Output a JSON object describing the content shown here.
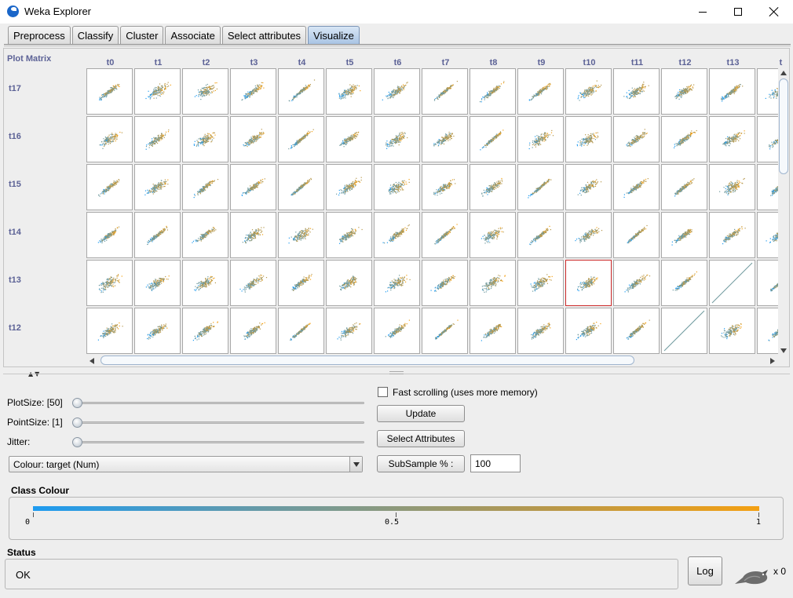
{
  "window": {
    "title": "Weka Explorer"
  },
  "tabs": [
    {
      "label": "Preprocess",
      "active": false
    },
    {
      "label": "Classify",
      "active": false
    },
    {
      "label": "Cluster",
      "active": false
    },
    {
      "label": "Associate",
      "active": false
    },
    {
      "label": "Select attributes",
      "active": false
    },
    {
      "label": "Visualize",
      "active": true
    }
  ],
  "plot_matrix": {
    "title": "Plot Matrix",
    "columns": [
      "t0",
      "t1",
      "t2",
      "t3",
      "t4",
      "t5",
      "t6",
      "t7",
      "t8",
      "t9",
      "t10",
      "t11",
      "t12",
      "t13",
      "t"
    ],
    "rows": [
      "t17",
      "t16",
      "t15",
      "t14",
      "t13",
      "t12"
    ],
    "selected_cell": {
      "row": "t13",
      "column": "t10"
    },
    "point_colors": [
      "#1e9bf0",
      "#6f9a9e",
      "#b6984c",
      "#f4a012"
    ]
  },
  "controls": {
    "plot_size_label": "PlotSize: [50]",
    "plot_size_value": 50,
    "point_size_label": "PointSize: [1]",
    "point_size_value": 1,
    "jitter_label": "Jitter:",
    "jitter_value": 0,
    "colour_select": "Colour: target  (Num)",
    "fast_scrolling_label": "Fast scrolling (uses more memory)",
    "fast_scrolling_checked": false,
    "update_button": "Update",
    "select_attributes_button": "Select Attributes",
    "subsample_button": "SubSample % :",
    "subsample_value": "100"
  },
  "class_colour": {
    "title": "Class Colour",
    "gradient": [
      "#1e9bf0",
      "#f4a012"
    ],
    "ticks": [
      "0",
      "0.5",
      "1"
    ]
  },
  "status": {
    "title": "Status",
    "text": "OK",
    "log_button": "Log",
    "task_count": "x 0"
  }
}
